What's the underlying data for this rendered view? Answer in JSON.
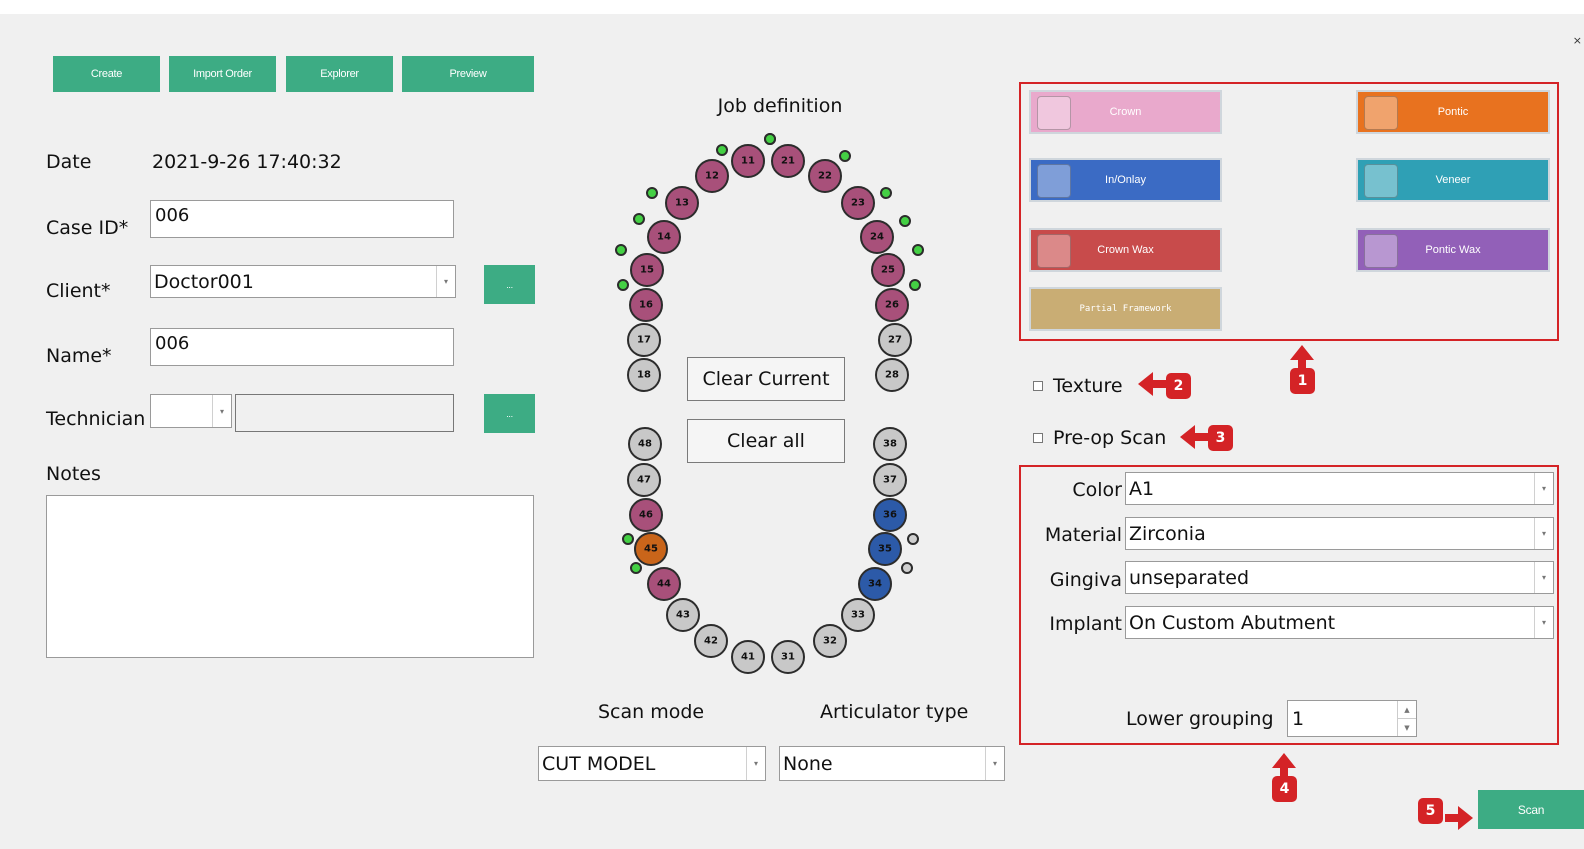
{
  "toolbar": {
    "create": "Create",
    "import_order": "Import Order",
    "explorer": "Explorer",
    "preview": "Preview"
  },
  "form": {
    "date_label": "Date",
    "date_value": "2021-9-26 17:40:32",
    "case_label": "Case ID*",
    "case_value": "006",
    "client_label": "Client*",
    "client_value": "Doctor001",
    "client_more": "...",
    "name_label": "Name*",
    "name_value": "006",
    "technician_label": "Technician",
    "technician_value": "",
    "technician_more": "...",
    "notes_label": "Notes",
    "notes_value": ""
  },
  "job": {
    "title": "Job definition",
    "clear_current": "Clear Current",
    "clear_all": "Clear all",
    "scan_mode_label": "Scan mode",
    "scan_mode_value": "CUT MODEL",
    "articulator_label": "Articulator type",
    "articulator_value": "None"
  },
  "teeth": [
    {
      "n": "11",
      "type": "crown",
      "dot": "green"
    },
    {
      "n": "21",
      "type": "crown",
      "dot": "green"
    },
    {
      "n": "12",
      "type": "crown",
      "dot": "green"
    },
    {
      "n": "22",
      "type": "crown",
      "dot": "green"
    },
    {
      "n": "13",
      "type": "crown",
      "dot": "green"
    },
    {
      "n": "23",
      "type": "crown",
      "dot": "green"
    },
    {
      "n": "14",
      "type": "crown",
      "dot": "green"
    },
    {
      "n": "24",
      "type": "crown",
      "dot": "green"
    },
    {
      "n": "15",
      "type": "crown",
      "dot": "green"
    },
    {
      "n": "25",
      "type": "crown",
      "dot": "green"
    },
    {
      "n": "16",
      "type": "crown",
      "dot": "green"
    },
    {
      "n": "26",
      "type": "crown",
      "dot": "green"
    },
    {
      "n": "17",
      "type": "none",
      "dot": ""
    },
    {
      "n": "27",
      "type": "none",
      "dot": ""
    },
    {
      "n": "18",
      "type": "none",
      "dot": ""
    },
    {
      "n": "28",
      "type": "none",
      "dot": ""
    },
    {
      "n": "48",
      "type": "none",
      "dot": ""
    },
    {
      "n": "38",
      "type": "none",
      "dot": ""
    },
    {
      "n": "47",
      "type": "none",
      "dot": ""
    },
    {
      "n": "37",
      "type": "none",
      "dot": ""
    },
    {
      "n": "46",
      "type": "crown",
      "dot": ""
    },
    {
      "n": "36",
      "type": "inlay",
      "dot": ""
    },
    {
      "n": "45",
      "type": "pontic",
      "dot": "green"
    },
    {
      "n": "35",
      "type": "inlay",
      "dot": "grey"
    },
    {
      "n": "44",
      "type": "crown",
      "dot": "green"
    },
    {
      "n": "34",
      "type": "inlay",
      "dot": "grey"
    },
    {
      "n": "43",
      "type": "none",
      "dot": ""
    },
    {
      "n": "33",
      "type": "none",
      "dot": ""
    },
    {
      "n": "42",
      "type": "none",
      "dot": ""
    },
    {
      "n": "32",
      "type": "none",
      "dot": ""
    },
    {
      "n": "41",
      "type": "none",
      "dot": ""
    },
    {
      "n": "31",
      "type": "none",
      "dot": ""
    }
  ],
  "tooth_colors": {
    "crown": "#a8507a",
    "inlay": "#2c5aa8",
    "pontic": "#c9651a",
    "none": "#c8c8c8",
    "dot_green": "#44d044",
    "dot_grey": "#cfcfcf"
  },
  "restoration_types": [
    {
      "label": "Crown",
      "color": "#e9a9cc",
      "icon": "crown-icon"
    },
    {
      "label": "Pontic",
      "color": "#e8721f",
      "icon": "pontic-icon"
    },
    {
      "label": "In/Onlay",
      "color": "#3b6bc4",
      "icon": "inlay-icon"
    },
    {
      "label": "Veneer",
      "color": "#2fa0b5",
      "icon": "veneer-icon"
    },
    {
      "label": "Crown Wax",
      "color": "#c84b4b",
      "icon": "crown-wax-icon"
    },
    {
      "label": "Pontic Wax",
      "color": "#9260b8",
      "icon": "pontic-wax-icon"
    },
    {
      "label": "Partial Framework",
      "color": "#c9ad74",
      "icon": ""
    }
  ],
  "options": {
    "texture": "Texture",
    "preop": "Pre-op Scan"
  },
  "props": {
    "color_label": "Color",
    "color_value": "A1",
    "material_label": "Material",
    "material_value": "Zirconia",
    "gingiva_label": "Gingiva",
    "gingiva_value": "unseparated",
    "implant_label": "Implant",
    "implant_value": "On Custom Abutment",
    "lower_label": "Lower grouping",
    "lower_value": "1"
  },
  "badges": [
    "1",
    "2",
    "3",
    "4",
    "5"
  ],
  "scan_label": "Scan"
}
